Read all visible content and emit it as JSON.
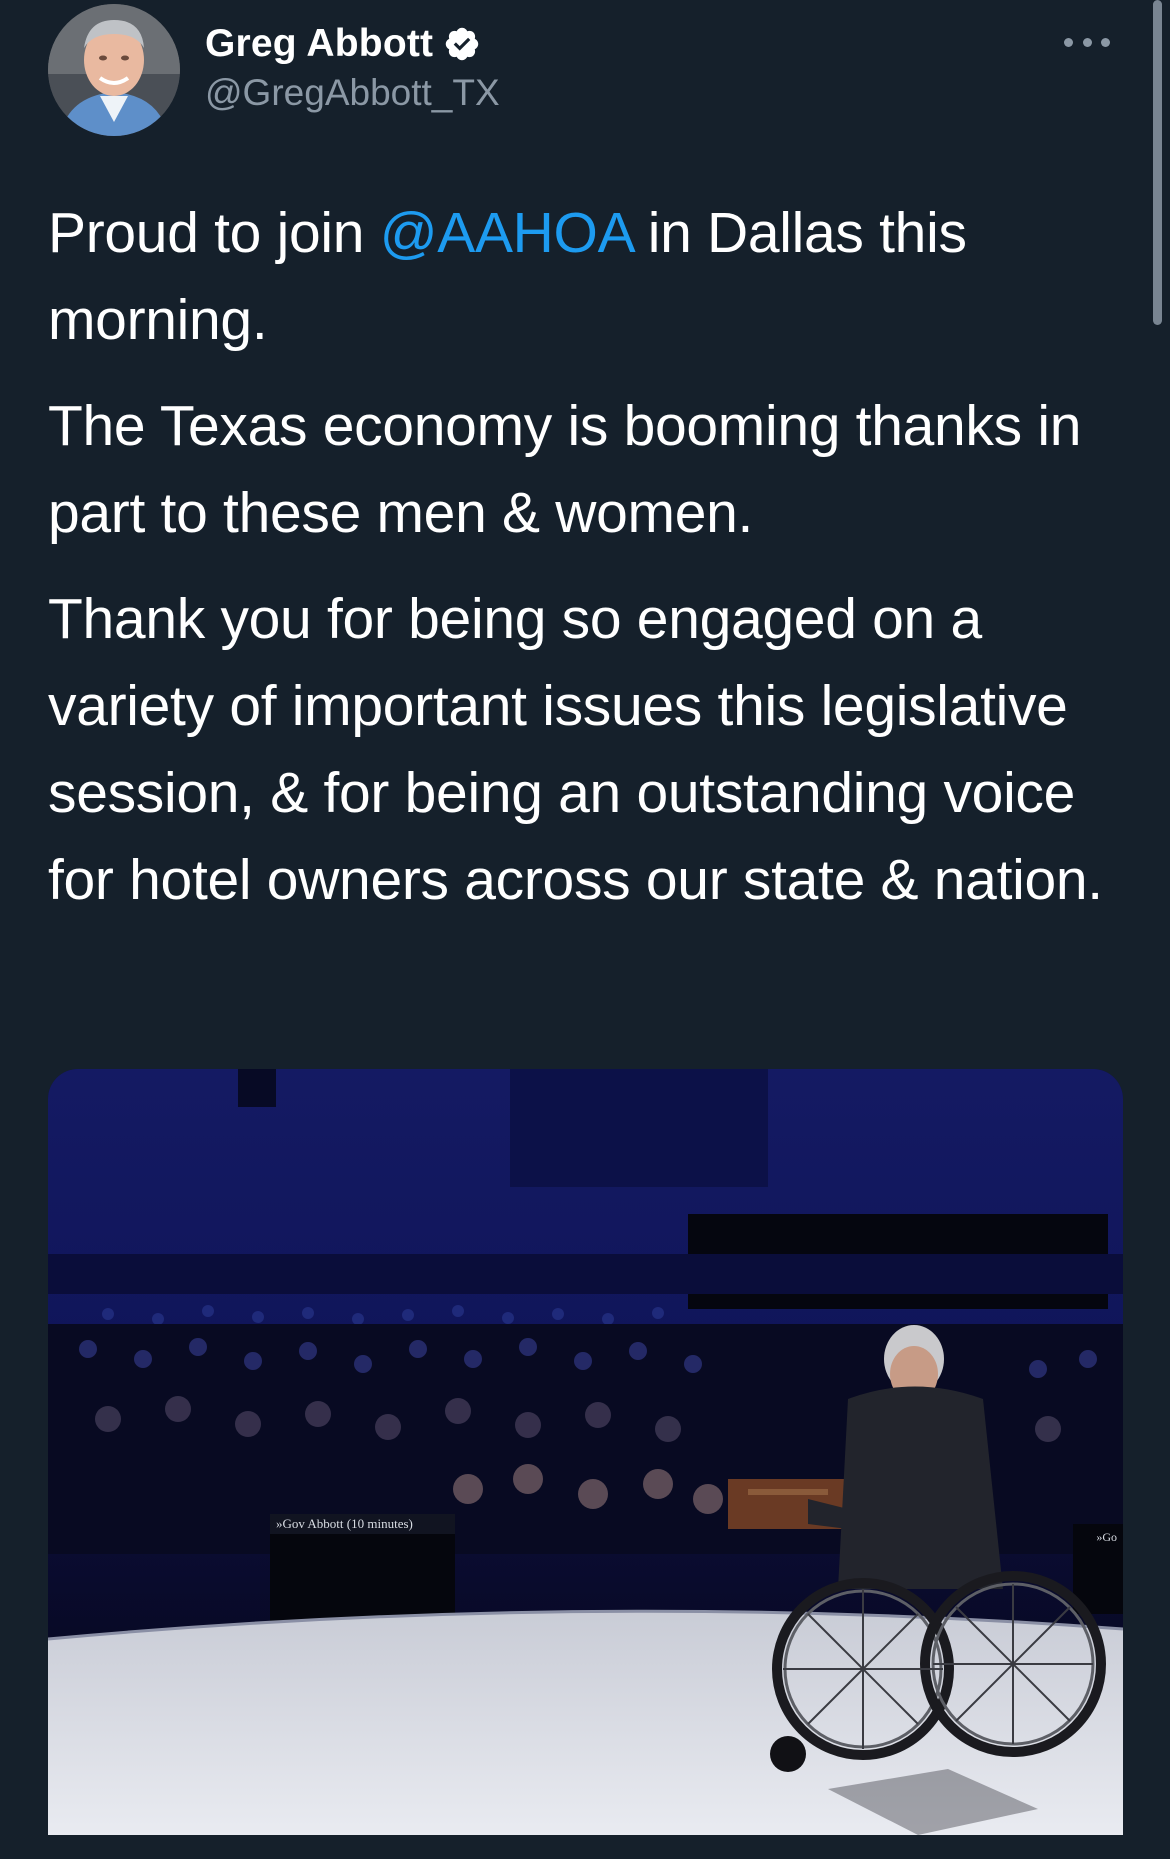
{
  "author": {
    "display_name": "Greg Abbott",
    "handle": "@GregAbbott_TX",
    "verified": true
  },
  "tweet": {
    "paragraph1_before": "Proud to join ",
    "mention": "@AAHOA",
    "paragraph1_after": " in Dallas this morning.",
    "paragraph2": "The Texas economy is booming thanks in part to these men & women.",
    "paragraph3": "Thank you for being so engaged on a variety of important issues this legislative session, & for being an outstanding voice for hotel owners across our state & nation."
  },
  "media": {
    "caption_left": "»Gov Abbott (10 minutes)",
    "caption_right": "»Go"
  },
  "icons": {
    "verified": "verified-badge-icon",
    "more": "more-options-icon"
  },
  "colors": {
    "background": "#15202b",
    "text": "#ffffff",
    "secondary_text": "#8b98a5",
    "link": "#1d9bf0"
  }
}
